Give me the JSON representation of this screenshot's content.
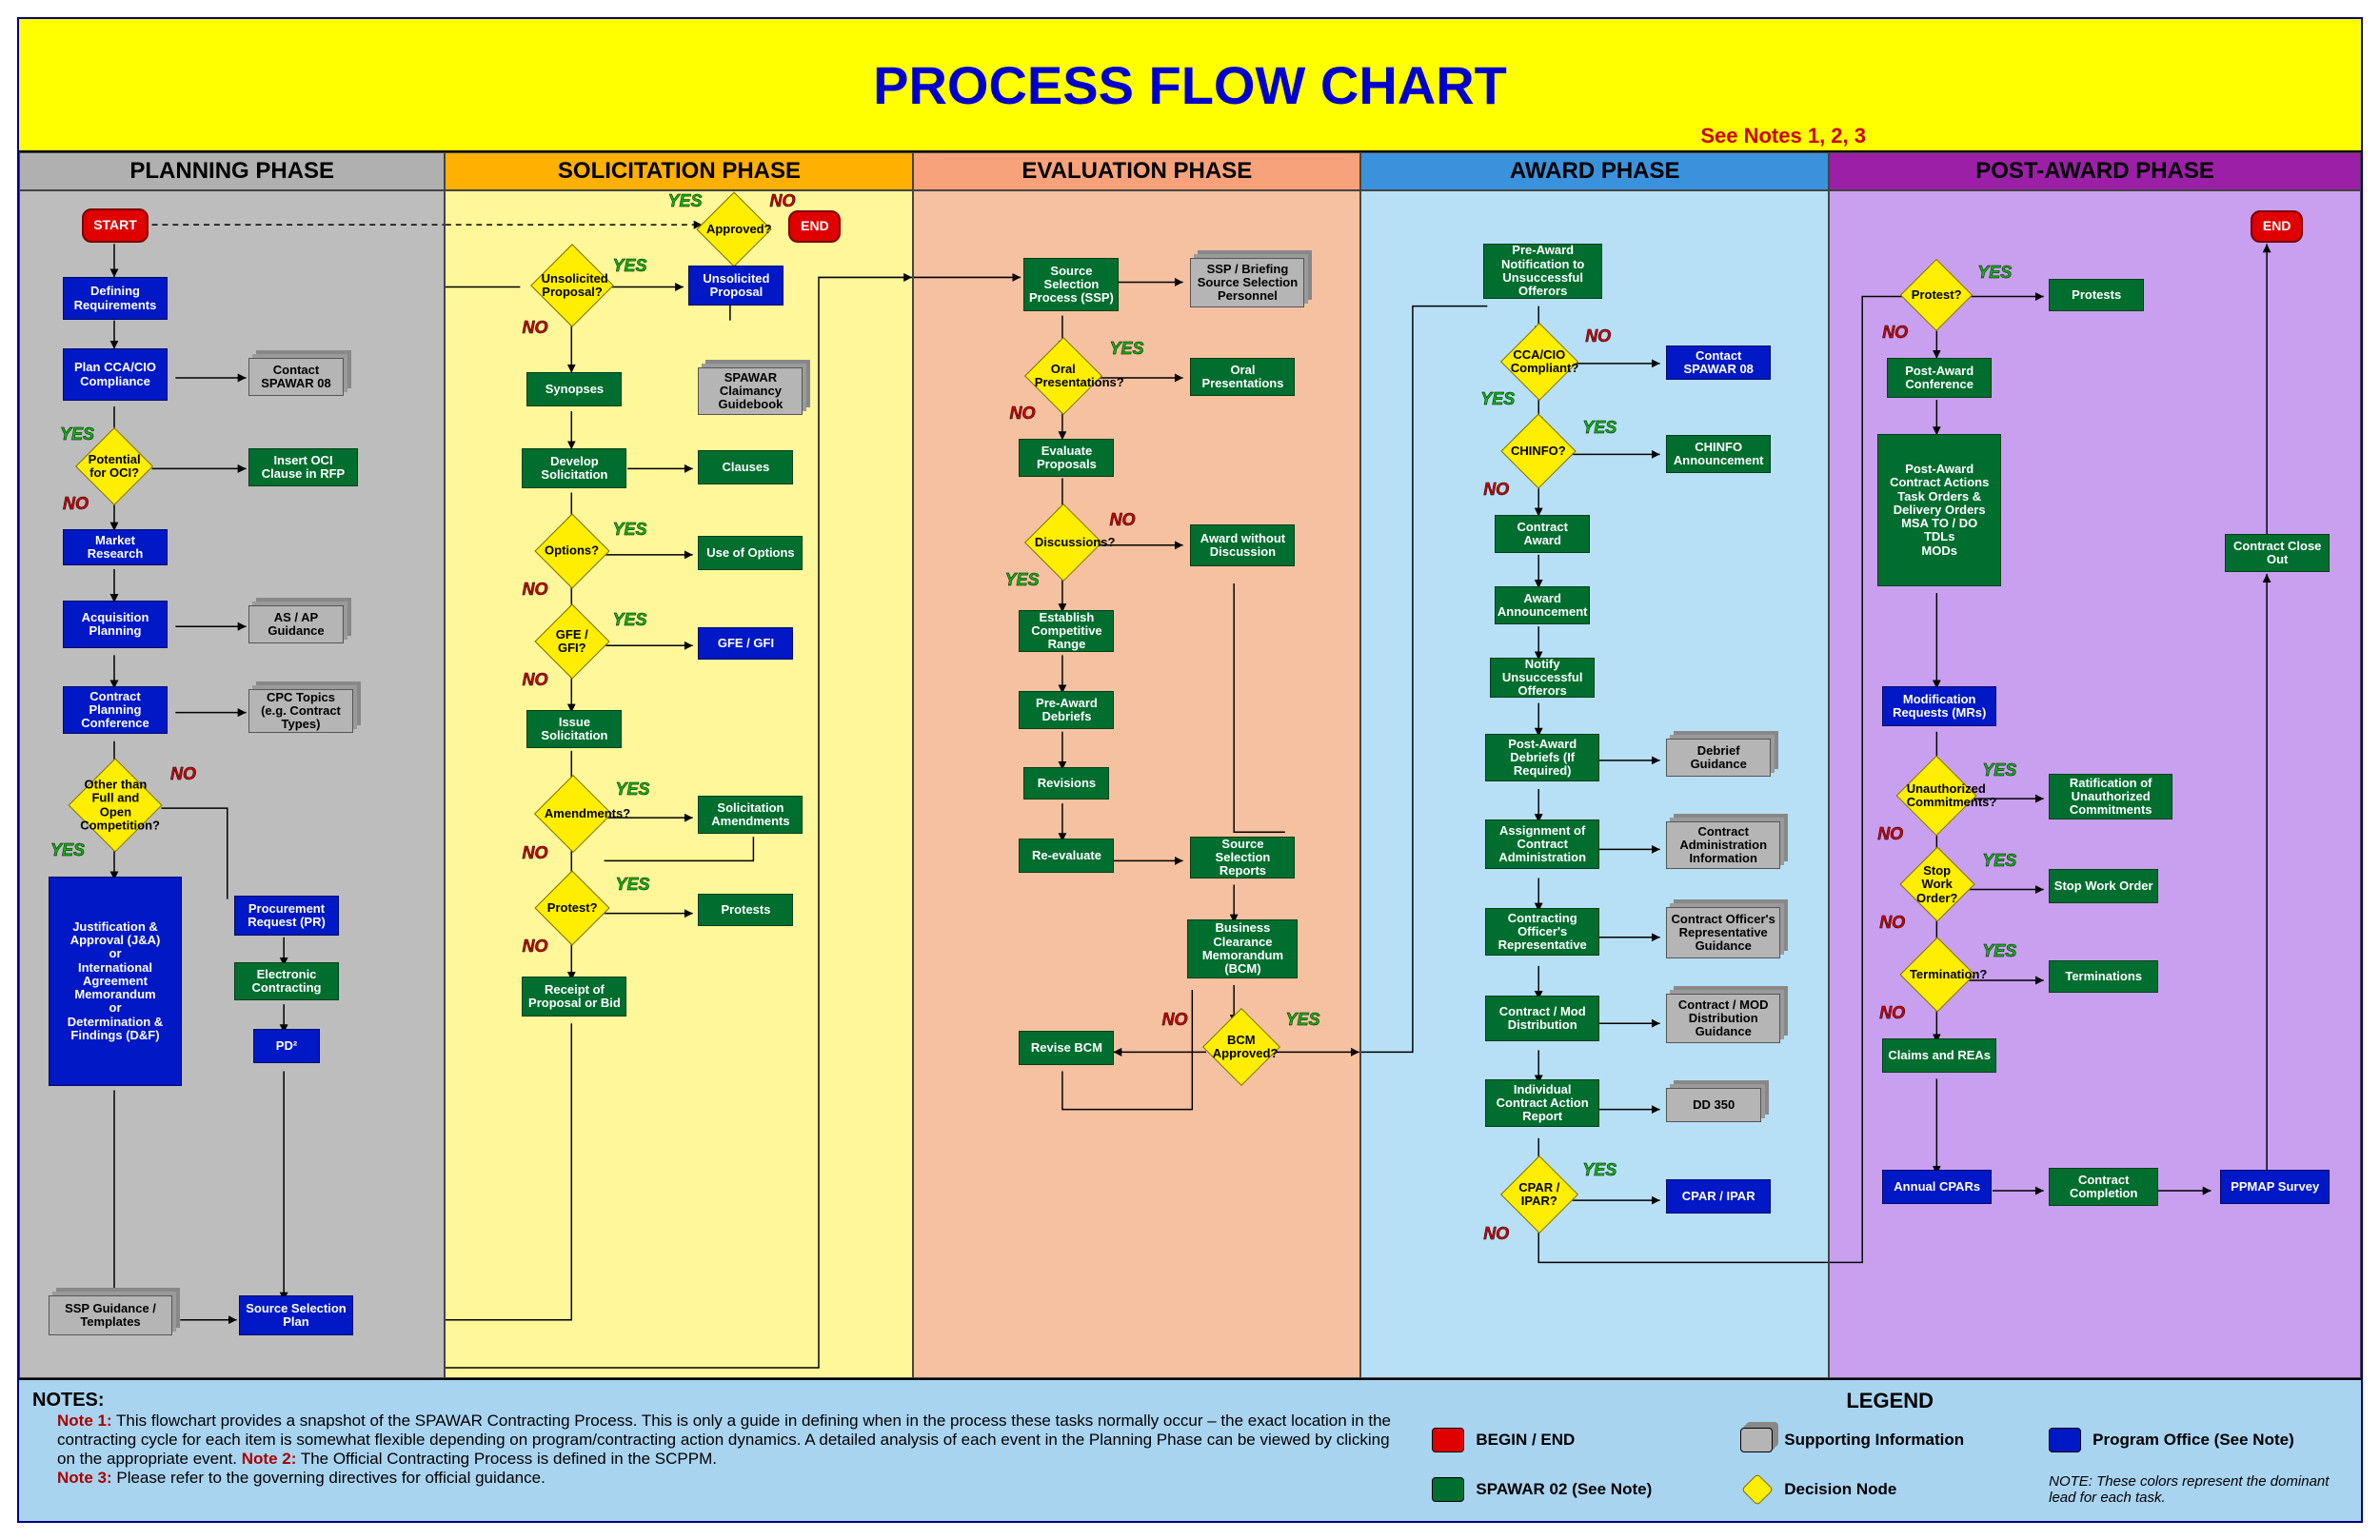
{
  "title": "PROCESS FLOW CHART",
  "see_notes": "See Notes 1, 2, 3",
  "phases": {
    "planning": "PLANNING PHASE",
    "solicitation": "SOLICITATION PHASE",
    "evaluation": "EVALUATION PHASE",
    "award": "AWARD PHASE",
    "postaward": "POST-AWARD PHASE"
  },
  "terminators": {
    "start": "START",
    "end": "END"
  },
  "planning": {
    "defining_req": "Defining Requirements",
    "plan_cca": "Plan CCA/CIO Compliance",
    "contact_spawar08": "Contact SPAWAR 08",
    "potential_oci": "Potential for OCI?",
    "insert_oci": "Insert OCI Clause in RFP",
    "market_research": "Market Research",
    "acq_planning": "Acquisition Planning",
    "as_ap_guidance": "AS / AP Guidance",
    "cpc_conference": "Contract Planning Conference",
    "cpc_topics": "CPC Topics (e.g. Contract Types)",
    "other_than_foc": "Other than Full and Open Competition?",
    "ja_block": "Justification & Approval (J&A)\nor\nInternational Agreement Memorandum\nor\nDetermination & Findings (D&F)",
    "procurement_request": "Procurement Request (PR)",
    "electronic_contracting": "Electronic Contracting",
    "pd2": "PD²",
    "ssp_templates": "SSP Guidance / Templates",
    "source_selection_plan": "Source Selection Plan"
  },
  "solicitation": {
    "approved": "Approved?",
    "unsolicited_q": "Unsolicited Proposal?",
    "unsolicited_proposal": "Unsolicited Proposal",
    "synopses": "Synopses",
    "spawar_guidebook": "SPAWAR Claimancy Guidebook",
    "develop_solicitation": "Develop Solicitation",
    "clauses": "Clauses",
    "options_q": "Options?",
    "use_of_options": "Use of Options",
    "gfe_q": "GFE / GFI?",
    "gfe_gfi": "GFE / GFI",
    "issue_solicitation": "Issue Solicitation",
    "amendments_q": "Amendments?",
    "solicitation_amendments": "Solicitation Amendments",
    "protest_q": "Protest?",
    "protests": "Protests",
    "receipt_bid": "Receipt of Proposal or Bid"
  },
  "evaluation": {
    "ssp": "Source Selection Process (SSP)",
    "ssp_briefing": "SSP / Briefing Source Selection Personnel",
    "oral_q": "Oral Presentations?",
    "oral_presentations": "Oral Presentations",
    "evaluate_proposals": "Evaluate Proposals",
    "discussions_q": "Discussions?",
    "award_without_discussion": "Award without Discussion",
    "establish_range": "Establish Competitive Range",
    "preaward_debriefs": "Pre-Award Debriefs",
    "revisions": "Revisions",
    "reevaluate": "Re-evaluate",
    "ssr": "Source Selection Reports",
    "bcm": "Business Clearance Memorandum (BCM)",
    "bcm_approved_q": "BCM Approved?",
    "revise_bcm": "Revise BCM"
  },
  "award": {
    "preaward_notif": "Pre-Award Notification to Unsuccessful Offerors",
    "cca_compliant_q": "CCA/CIO Compliant?",
    "contact_spawar08": "Contact SPAWAR 08",
    "chinfo_q": "CHINFO?",
    "chinfo_announcement": "CHINFO Announcement",
    "contract_award": "Contract Award",
    "award_announcement": "Award Announcement",
    "notify_unsuccessful": "Notify Unsuccessful Offerors",
    "postaward_debriefs": "Post-Award Debriefs (If Required)",
    "debrief_guidance": "Debrief Guidance",
    "assign_admin": "Assignment of Contract Administration",
    "admin_info": "Contract Administration Information",
    "cor": "Contracting Officer's Representative",
    "cor_guidance": "Contract Officer's Representative Guidance",
    "contract_mod_dist": "Contract / Mod Distribution",
    "contract_mod_guidance": "Contract / MOD Distribution Guidance",
    "action_report": "Individual Contract Action Report",
    "dd350": "DD 350",
    "cpar_q": "CPAR / IPAR?",
    "cpar_ipar": "CPAR / IPAR"
  },
  "postaward": {
    "protest_q": "Protest?",
    "protests": "Protests",
    "postaward_conference": "Post-Award Conference",
    "contract_actions": "Post-Award Contract Actions\nTask Orders & Delivery Orders\nMSA TO / DO\nTDLs\nMODs",
    "mod_requests": "Modification Requests (MRs)",
    "unauth_commit_q": "Unauthorized Commitments?",
    "ratification": "Ratification of Unauthorized Commitments",
    "stop_work_q": "Stop Work Order?",
    "stop_work": "Stop Work Order",
    "termination_q": "Termination?",
    "terminations": "Terminations",
    "claims_reas": "Claims and REAs",
    "annual_cpars": "Annual CPARs",
    "contract_completion": "Contract Completion",
    "ppmap_survey": "PPMAP Survey",
    "contract_closeout": "Contract Close Out"
  },
  "labels": {
    "yes": "YES",
    "no": "NO"
  },
  "notes": {
    "header": "NOTES:",
    "n1_label": "Note 1:",
    "n1": "This flowchart provides a snapshot of the SPAWAR Contracting Process. This is only a guide in defining when in the process these tasks normally occur – the exact location in the contracting cycle for each item is somewhat flexible depending on program/contracting action dynamics.  A detailed analysis of each event in the Planning Phase can be viewed by clicking on the appropriate event.",
    "n2_label": "Note 2:",
    "n2": "The Official Contracting Process is defined in the SCPPM.",
    "n3_label": "Note 3:",
    "n3": "Please refer to the governing directives for official guidance."
  },
  "legend": {
    "title": "LEGEND",
    "begin_end": "BEGIN / END",
    "supporting": "Supporting Information",
    "program_office": "Program Office (See Note)",
    "spawar02": "SPAWAR 02 (See Note)",
    "decision": "Decision Node",
    "note": "NOTE:  These colors represent the dominant lead for each task."
  },
  "colors": {
    "terminator": "#e00000",
    "process_green": "#006e2e",
    "process_blue": "#0018c5",
    "decision": "#ffee00",
    "document": "#b5b5b5"
  }
}
